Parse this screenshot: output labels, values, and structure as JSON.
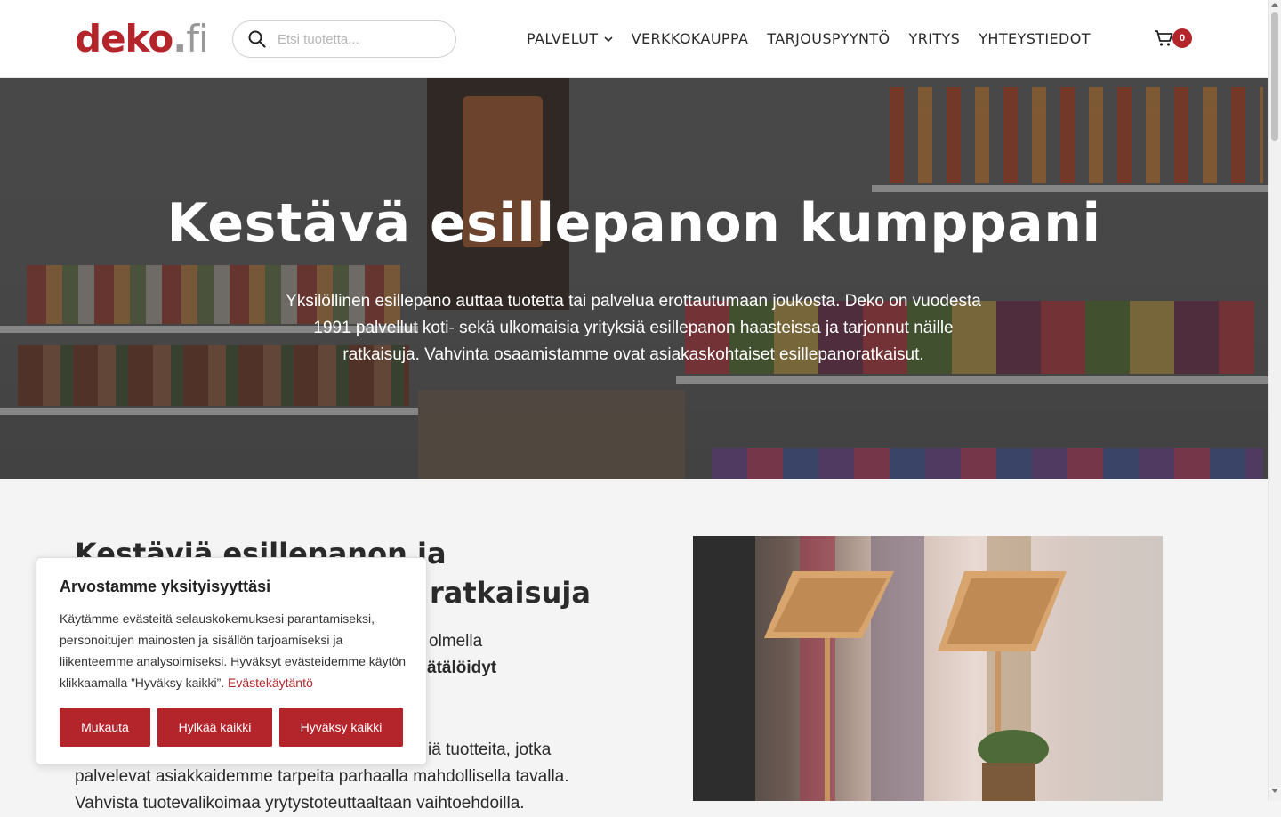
{
  "header": {
    "logo": {
      "main": "deko",
      "dot": ".",
      "tld": "fi"
    },
    "search": {
      "placeholder": "Etsi tuotetta..."
    },
    "nav": [
      {
        "label": "PALVELUT",
        "has_dropdown": true
      },
      {
        "label": "VERKKOKAUPPA"
      },
      {
        "label": "TARJOUSPYYNTÖ"
      },
      {
        "label": "YRITYS"
      },
      {
        "label": "YHTEYSTIEDOT"
      }
    ],
    "cart_count": "0"
  },
  "hero": {
    "title": "Kestävä esillepanon kumppani",
    "text": "Yksilöllinen esillepano auttaa tuotetta tai palvelua erottautumaan joukosta. Deko on vuodesta 1991 palvellut koti- sekä ulkomaisia yrityksiä esillepanon haasteissa ja tarjonnut näille ratkaisuja. Vahvinta osaamistamme ovat asiakaskohtaiset esillepanoratkaisut."
  },
  "section": {
    "title_line1": "Kestäviä esillepanon ja",
    "title_line2": "ratkaisuja",
    "text_line1": "olmella",
    "text_line2_bold": "ätälöidyt",
    "text_para_line1": "iä tuotteita, jotka",
    "text_para_line2": "palvelevat asiakkaidemme tarpeita parhaalla mahdollisella tavalla.",
    "text_para_line3": "Vahvista tuotevalikoimaa yrytystoteuttaaltaan vaihtoehdoilla."
  },
  "cookie": {
    "title": "Arvostamme yksityisyyttäsi",
    "text": "Käytämme evästeitä selauskokemuksesi parantamiseksi, personoitujen mainosten ja sisällön tarjoamiseksi ja liikenteemme analysoimiseksi. Hyväksyt evästeidemme käytön klikkaamalla ”Hyväksy kaikki”.",
    "policy_link": "Evästekäytäntö",
    "buttons": {
      "customize": "Mukauta",
      "reject": "Hylkää kaikki",
      "accept": "Hyväksy kaikki"
    }
  },
  "colors": {
    "brand": "#b3242b",
    "logo_grey": "#999999"
  }
}
